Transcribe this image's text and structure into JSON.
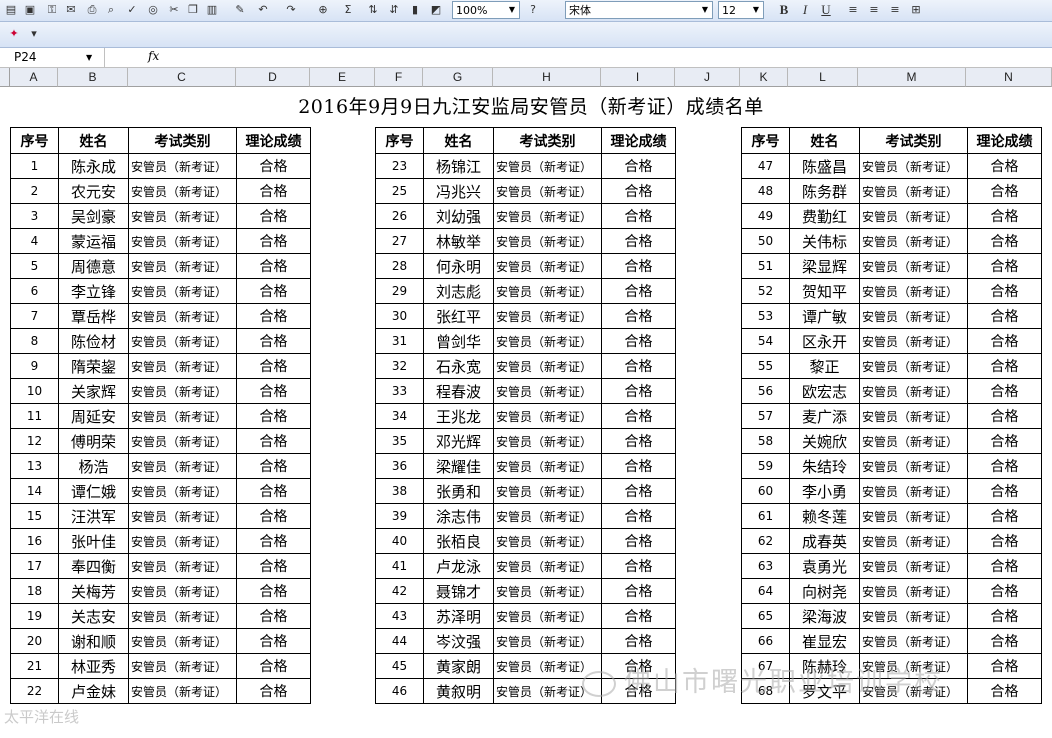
{
  "toolbar": {
    "zoom": "100%",
    "font_name": "宋体",
    "font_size": "12",
    "bold": "B",
    "italic": "I",
    "underline": "U",
    "sum": "Σ"
  },
  "formula_bar": {
    "cell_ref": "P24",
    "fx": "fx",
    "value": ""
  },
  "columns": [
    "A",
    "B",
    "C",
    "D",
    "E",
    "F",
    "G",
    "H",
    "I",
    "J",
    "K",
    "L",
    "M",
    "N"
  ],
  "sheet": {
    "title": "2016年9月9日九江安监局安管员（新考证）成绩名单",
    "headers": [
      "序号",
      "姓名",
      "考试类别",
      "理论成绩"
    ],
    "category": "安管员（新考证）",
    "result": "合格",
    "blocks": [
      {
        "rows": [
          {
            "no": "1",
            "name": "陈永成"
          },
          {
            "no": "2",
            "name": "农元安"
          },
          {
            "no": "3",
            "name": "吴剑豪"
          },
          {
            "no": "4",
            "name": "蒙运福"
          },
          {
            "no": "5",
            "name": "周德意"
          },
          {
            "no": "6",
            "name": "李立锋"
          },
          {
            "no": "7",
            "name": "覃岳桦"
          },
          {
            "no": "8",
            "name": "陈俭材"
          },
          {
            "no": "9",
            "name": "隋荣鋆"
          },
          {
            "no": "10",
            "name": "关家辉"
          },
          {
            "no": "11",
            "name": "周延安"
          },
          {
            "no": "12",
            "name": "傅明荣"
          },
          {
            "no": "13",
            "name": "杨浩"
          },
          {
            "no": "14",
            "name": "谭仁娥"
          },
          {
            "no": "15",
            "name": "汪洪军"
          },
          {
            "no": "16",
            "name": "张叶佳"
          },
          {
            "no": "17",
            "name": "奉四衡"
          },
          {
            "no": "18",
            "name": "关梅芳"
          },
          {
            "no": "19",
            "name": "关志安"
          },
          {
            "no": "20",
            "name": "谢和顺"
          },
          {
            "no": "21",
            "name": "林亚秀"
          },
          {
            "no": "22",
            "name": "卢金妹"
          }
        ]
      },
      {
        "rows": [
          {
            "no": "23",
            "name": "杨锦江"
          },
          {
            "no": "25",
            "name": "冯兆兴"
          },
          {
            "no": "26",
            "name": "刘幼强"
          },
          {
            "no": "27",
            "name": "林敏举"
          },
          {
            "no": "28",
            "name": "何永明"
          },
          {
            "no": "29",
            "name": "刘志彪"
          },
          {
            "no": "30",
            "name": "张红平"
          },
          {
            "no": "31",
            "name": "曾剑华"
          },
          {
            "no": "32",
            "name": "石永宽"
          },
          {
            "no": "33",
            "name": "程春波"
          },
          {
            "no": "34",
            "name": "王兆龙"
          },
          {
            "no": "35",
            "name": "邓光辉"
          },
          {
            "no": "36",
            "name": "梁耀佳"
          },
          {
            "no": "38",
            "name": "张勇和"
          },
          {
            "no": "39",
            "name": "涂志伟"
          },
          {
            "no": "40",
            "name": "张栢良"
          },
          {
            "no": "41",
            "name": "卢龙泳"
          },
          {
            "no": "42",
            "name": "聂锦才"
          },
          {
            "no": "43",
            "name": "苏泽明"
          },
          {
            "no": "44",
            "name": "岑汶强"
          },
          {
            "no": "45",
            "name": "黄家朗"
          },
          {
            "no": "46",
            "name": "黄叙明"
          }
        ]
      },
      {
        "rows": [
          {
            "no": "47",
            "name": "陈盛昌"
          },
          {
            "no": "48",
            "name": "陈务群"
          },
          {
            "no": "49",
            "name": "费勤红"
          },
          {
            "no": "50",
            "name": "关伟标"
          },
          {
            "no": "51",
            "name": "梁显辉"
          },
          {
            "no": "52",
            "name": "贺知平"
          },
          {
            "no": "53",
            "name": "谭广敏"
          },
          {
            "no": "54",
            "name": "区永开"
          },
          {
            "no": "55",
            "name": "黎正"
          },
          {
            "no": "56",
            "name": "欧宏志"
          },
          {
            "no": "57",
            "name": "麦广添"
          },
          {
            "no": "58",
            "name": "关婉欣"
          },
          {
            "no": "59",
            "name": "朱结玲"
          },
          {
            "no": "60",
            "name": "李小勇"
          },
          {
            "no": "61",
            "name": "赖冬莲"
          },
          {
            "no": "62",
            "name": "成春英"
          },
          {
            "no": "63",
            "name": "袁勇光"
          },
          {
            "no": "64",
            "name": "向树尧"
          },
          {
            "no": "65",
            "name": "梁海波"
          },
          {
            "no": "66",
            "name": "崔显宏"
          },
          {
            "no": "67",
            "name": "陈赫玲"
          },
          {
            "no": "68",
            "name": "罗文平"
          }
        ]
      }
    ]
  },
  "watermarks": {
    "main": "佛山市曙光职业培训学校",
    "corner": "太平洋在线"
  }
}
